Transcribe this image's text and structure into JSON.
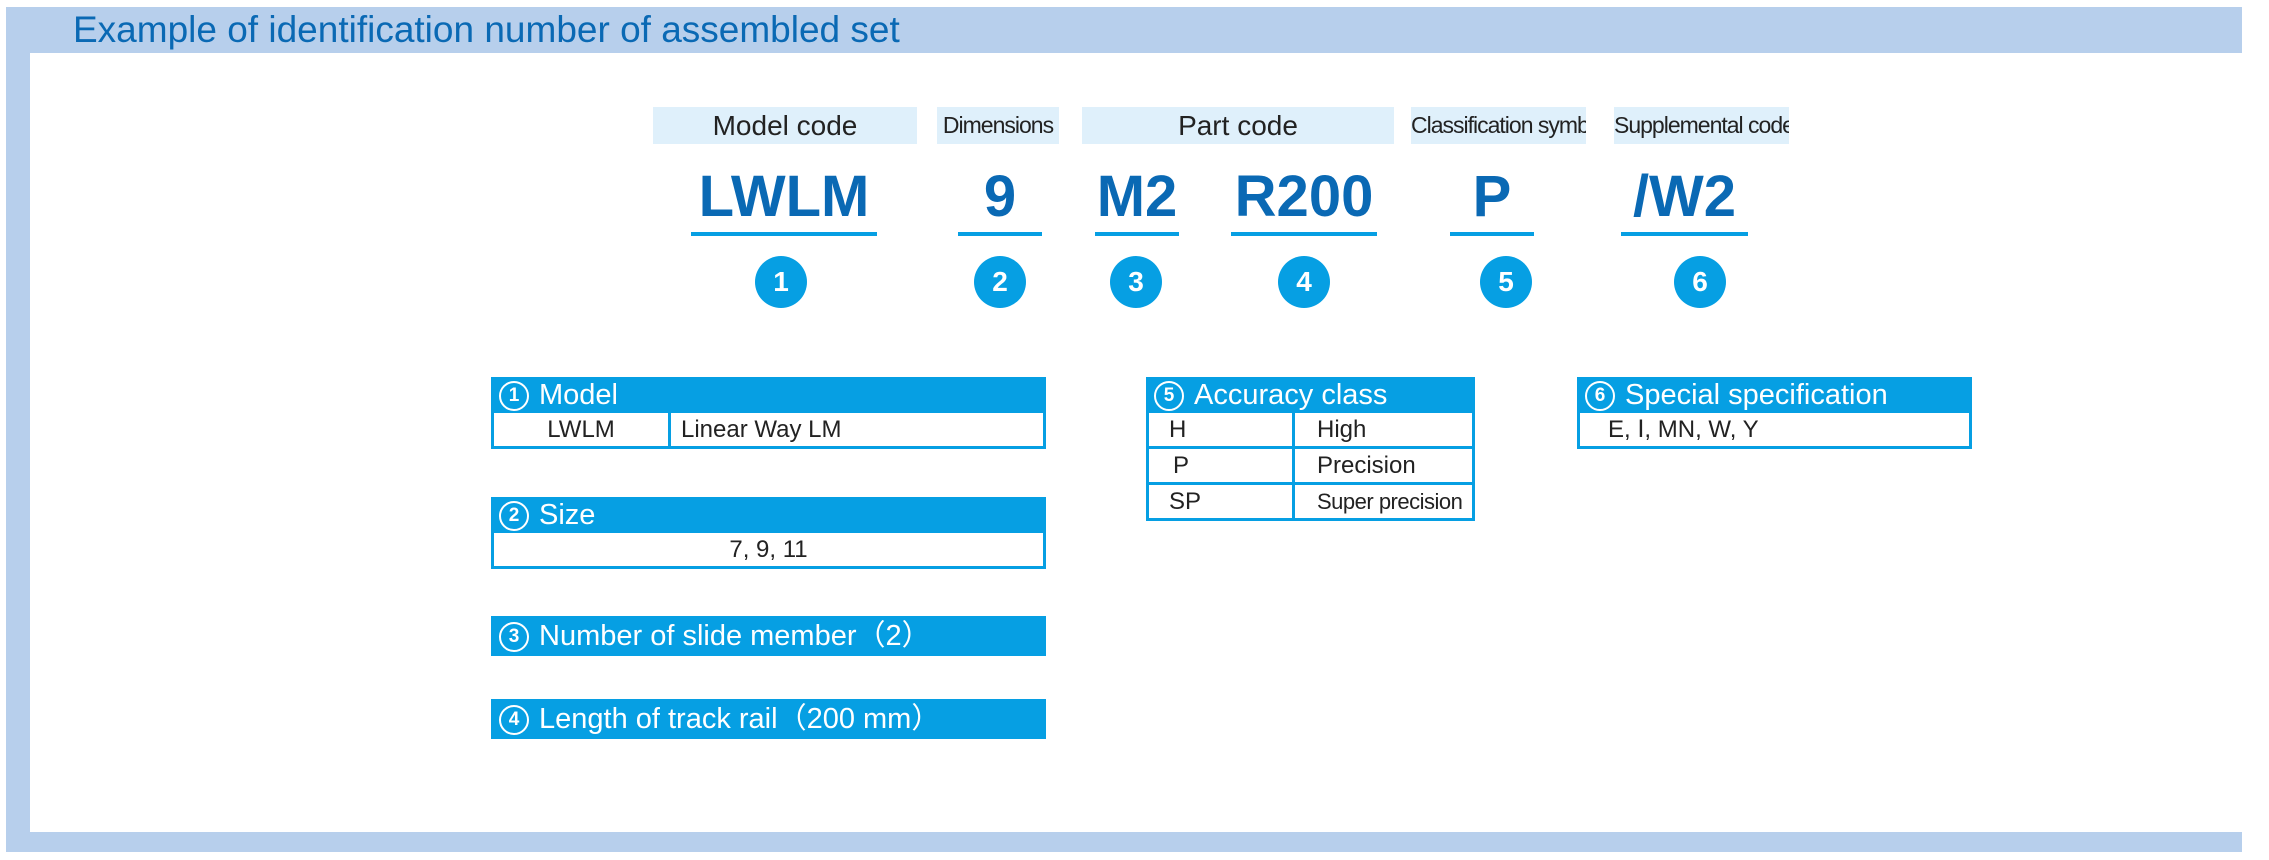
{
  "title": "Example of identification number of assembled set",
  "code_labels": [
    {
      "id": "model-code",
      "text": "Model code"
    },
    {
      "id": "dimensions",
      "text": "Dimensions"
    },
    {
      "id": "part-code",
      "text": "Part code"
    },
    {
      "id": "classification-symbol",
      "text": "Classification symbol"
    },
    {
      "id": "supplemental-code",
      "text": "Supplemental code"
    }
  ],
  "code_parts": [
    {
      "value": "LWLM",
      "number": "1"
    },
    {
      "value": "9",
      "number": "2"
    },
    {
      "value": "M2",
      "number": "3"
    },
    {
      "value": "R200",
      "number": "4"
    },
    {
      "value": "P",
      "number": "5"
    },
    {
      "value": "/W2",
      "number": "6"
    }
  ],
  "tables": {
    "model": {
      "number": "1",
      "title": "Model",
      "rows": [
        [
          "LWLM",
          "Linear Way LM"
        ]
      ]
    },
    "size": {
      "number": "2",
      "title": "Size",
      "rows": [
        [
          "7, 9, 11"
        ]
      ]
    },
    "slide_member": {
      "number": "3",
      "title": "Number of slide member（2）"
    },
    "track_rail": {
      "number": "4",
      "title": "Length of track rail（200 mm）"
    },
    "accuracy": {
      "number": "5",
      "title": "Accuracy class",
      "rows": [
        [
          "H",
          "High"
        ],
        [
          "P",
          "Precision"
        ],
        [
          "SP",
          "Super precision"
        ]
      ]
    },
    "special": {
      "number": "6",
      "title": "Special specification",
      "rows": [
        [
          "E, Ⅰ, MN, W, Y"
        ]
      ]
    }
  },
  "colors": {
    "frame": "#b7cfec",
    "title_blue": "#0a69b4",
    "accent_cyan": "#069fe3",
    "label_bg": "#dff0fb"
  }
}
